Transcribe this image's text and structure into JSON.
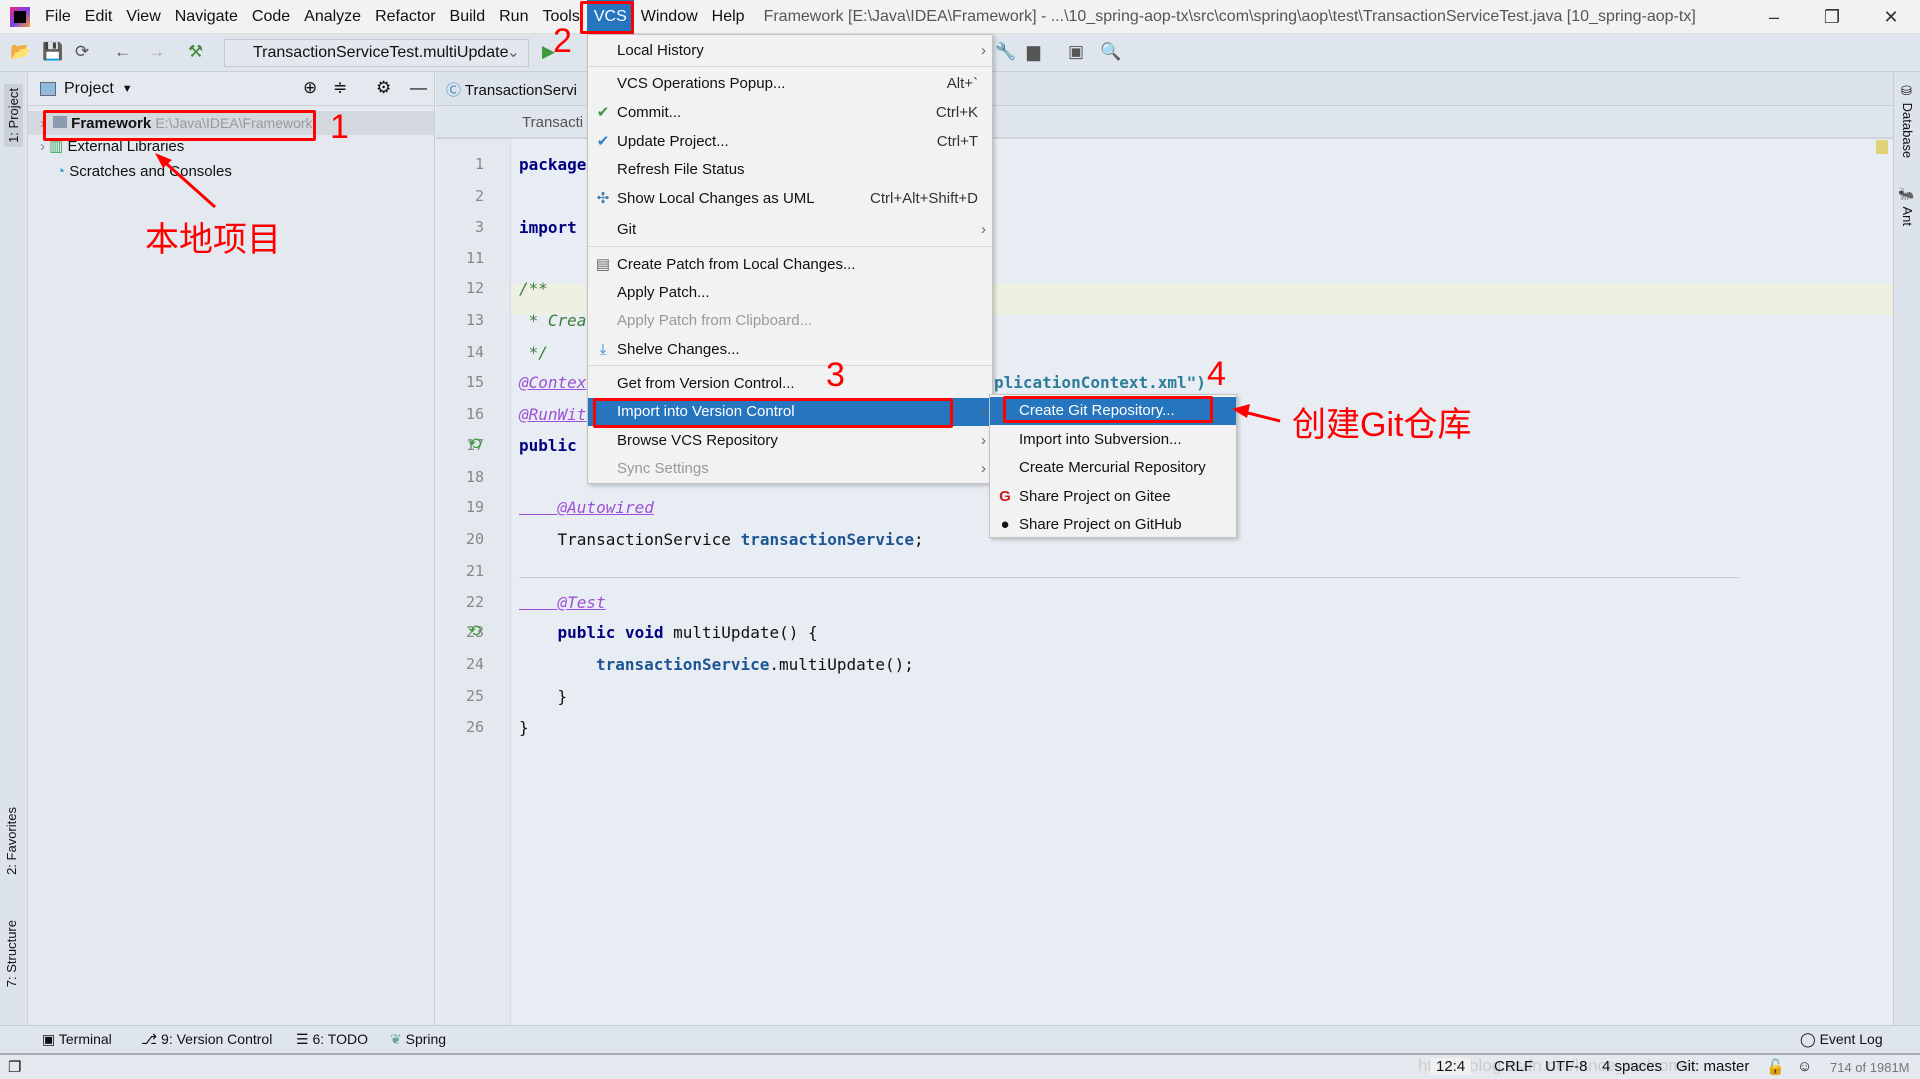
{
  "menubar": {
    "items": [
      "File",
      "Edit",
      "View",
      "Navigate",
      "Code",
      "Analyze",
      "Refactor",
      "Build",
      "Run",
      "Tools",
      "VCS",
      "Window",
      "Help"
    ],
    "title": "Framework [E:\\Java\\IDEA\\Framework] - ...\\10_spring-aop-tx\\src\\com\\spring\\aop\\test\\TransactionServiceTest.java [10_spring-aop-tx]"
  },
  "toolbar": {
    "run_config": "TransactionServiceTest.multiUpdate"
  },
  "left_strip": {
    "project": "1: Project",
    "favorites": "2: Favorites",
    "structure": "7: Structure"
  },
  "right_strip": {
    "database": "Database",
    "ant": "Ant"
  },
  "project_panel": {
    "title": "Project",
    "tree": [
      {
        "label": "Framework",
        "path": "E:\\Java\\IDEA\\Framework"
      },
      {
        "label": "External Libraries"
      },
      {
        "label": "Scratches and Consoles"
      }
    ]
  },
  "editor": {
    "tab": "TransactionServi",
    "breadcrumb": "Transacti",
    "lines": [
      {
        "n": "1",
        "text": "package"
      },
      {
        "n": "2",
        "text": ""
      },
      {
        "n": "3",
        "text": "import"
      },
      {
        "n": "11",
        "text": ""
      },
      {
        "n": "12",
        "text": "/**"
      },
      {
        "n": "13",
        "text": " * Crea"
      },
      {
        "n": "14",
        "text": " */"
      },
      {
        "n": "15",
        "text": "@Contex",
        "tail": "plicationContext.xml\")"
      },
      {
        "n": "16",
        "text": "@RunWit"
      },
      {
        "n": "17",
        "text": "public"
      },
      {
        "n": "18",
        "text": ""
      },
      {
        "n": "19",
        "text": "    @Autowired"
      },
      {
        "n": "20",
        "text": "    TransactionService ",
        "field": "transactionService",
        ";": ";"
      },
      {
        "n": "21",
        "text": ""
      },
      {
        "n": "22",
        "text": "    @Test"
      },
      {
        "n": "23",
        "text": "    public void multiUpdate() {"
      },
      {
        "n": "24",
        "field": "transactionService",
        "rest": ".multiUpdate();"
      },
      {
        "n": "25",
        "text": "    }"
      },
      {
        "n": "26",
        "text": "}"
      }
    ]
  },
  "vcs_menu": {
    "items": [
      {
        "label": "Local History",
        "submenu": true
      },
      {
        "label": "VCS Operations Popup...",
        "shortcut": "Alt+`"
      },
      {
        "label": "Commit...",
        "shortcut": "Ctrl+K",
        "icon": "check-icon"
      },
      {
        "label": "Update Project...",
        "shortcut": "Ctrl+T",
        "icon": "update-icon"
      },
      {
        "label": "Refresh File Status"
      },
      {
        "label": "Show Local Changes as UML",
        "shortcut": "Ctrl+Alt+Shift+D",
        "icon": "uml-icon"
      },
      {
        "label": "Git",
        "submenu": true
      },
      {
        "label": "Create Patch from Local Changes...",
        "icon": "patch-icon"
      },
      {
        "label": "Apply Patch..."
      },
      {
        "label": "Apply Patch from Clipboard...",
        "disabled": true
      },
      {
        "label": "Shelve Changes...",
        "icon": "shelve-icon"
      },
      {
        "label": "Get from Version Control..."
      },
      {
        "label": "Import into Version Control",
        "submenu": true,
        "selected": true
      },
      {
        "label": "Browse VCS Repository",
        "submenu": true
      },
      {
        "label": "Sync Settings",
        "submenu": true,
        "disabled": true
      }
    ]
  },
  "import_submenu": {
    "items": [
      {
        "label": "Create Git Repository...",
        "selected": true
      },
      {
        "label": "Import into Subversion..."
      },
      {
        "label": "Create Mercurial Repository"
      },
      {
        "label": "Share Project on Gitee",
        "icon": "gitee-icon"
      },
      {
        "label": "Share Project on GitHub",
        "icon": "github-icon"
      }
    ]
  },
  "bottom_tools": [
    "Terminal",
    "9: Version Control",
    "6: TODO",
    "Spring"
  ],
  "event_log": "Event Log",
  "status": {
    "position": "12:4",
    "line_sep": "CRLF",
    "encoding": "UTF-8",
    "indent": "4 spaces",
    "vcs": "Git: master",
    "memory": "714 of 1981M",
    "watermark": "https://blog.csdn.net/lance_welcome"
  },
  "annotations": {
    "n1": "1",
    "n2": "2",
    "n3": "3",
    "n4": "4",
    "local_project": "本地项目",
    "create_git_repo": "创建Git仓库"
  },
  "colors": {
    "selection": "#2675bf",
    "annotation": "#ff0000"
  }
}
